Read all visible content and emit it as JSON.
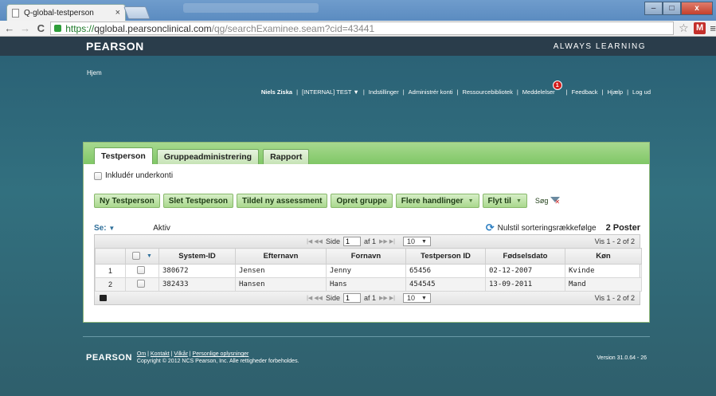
{
  "browser": {
    "tab_title": "Q-global-testperson",
    "tab_close": "×",
    "url_https": "https://",
    "url_host": "qglobal.pearsonclinical.com",
    "url_path": "/qg/searchExaminee.seam?cid=43441",
    "back_icon": "←",
    "forward_icon": "→",
    "reload_icon": "C",
    "star_icon": "☆",
    "ext_icon": "M",
    "menu_icon": "≡",
    "win_min": "–",
    "win_max": "□",
    "win_close": "x"
  },
  "site": {
    "logo": "PEARSON",
    "tagline": "ALWAYS LEARNING",
    "home_link": "Hjem",
    "nav": {
      "user": "Niels Ziska",
      "org": "[INTERNAL] TEST",
      "org_caret": "▼",
      "settings": "Indstillinger",
      "admin": "Administrér konti",
      "library": "Ressourcebibliotek",
      "messages": "Meddelelser",
      "messages_badge": "1",
      "feedback": "Feedback",
      "help": "Hjælp",
      "logout": "Log ud",
      "sep": "|"
    }
  },
  "tabs": [
    {
      "label": "Testperson"
    },
    {
      "label": "Gruppeadministrering"
    },
    {
      "label": "Rapport"
    }
  ],
  "include_subaccounts": "Inkludér underkonti",
  "actions": {
    "new": "Ny Testperson",
    "delete": "Slet Testperson",
    "assign": "Tildel ny assessment",
    "create_group": "Opret gruppe",
    "more": "Flere handlinger",
    "move": "Flyt til",
    "search": "Søg",
    "dropdown_caret": "▼"
  },
  "filter": {
    "view_label": "Se:",
    "view_caret": "▼",
    "status": "Aktiv",
    "reset_sort": "Nulstil sorteringsrækkefølge",
    "refresh_icon": "⟳",
    "count": "2 Poster"
  },
  "pager": {
    "first_prev": "|◀ ◀◀",
    "next_last": "▶▶ ▶|",
    "side_label": "Side",
    "page_value": "1",
    "of_label": "af 1",
    "rows": "10",
    "rows_caret": "▼",
    "view_count": "Vis 1 - 2 of 2"
  },
  "table": {
    "header_caret": "▼",
    "columns": [
      "System-ID",
      "Efternavn",
      "Fornavn",
      "Testperson ID",
      "Fødselsdato",
      "Køn"
    ],
    "rows": [
      {
        "n": "1",
        "system_id": "380672",
        "last": "Jensen",
        "first": "Jenny",
        "tp_id": "65456",
        "dob": "02-12-2007",
        "sex": "Kvinde"
      },
      {
        "n": "2",
        "system_id": "382433",
        "last": "Hansen",
        "first": "Hans",
        "tp_id": "454545",
        "dob": "13-09-2011",
        "sex": "Mand"
      }
    ]
  },
  "footer": {
    "logo": "PEARSON",
    "about": "Om",
    "contact": "Kontakt",
    "terms": "Vilkår",
    "privacy": "Personlige oplysninger",
    "sep": "|",
    "copyright": "Copyright © 2012 NCS Pearson, Inc. Alle rettigheder forbeholdes.",
    "version": "Version 31.0.64 - 26"
  }
}
